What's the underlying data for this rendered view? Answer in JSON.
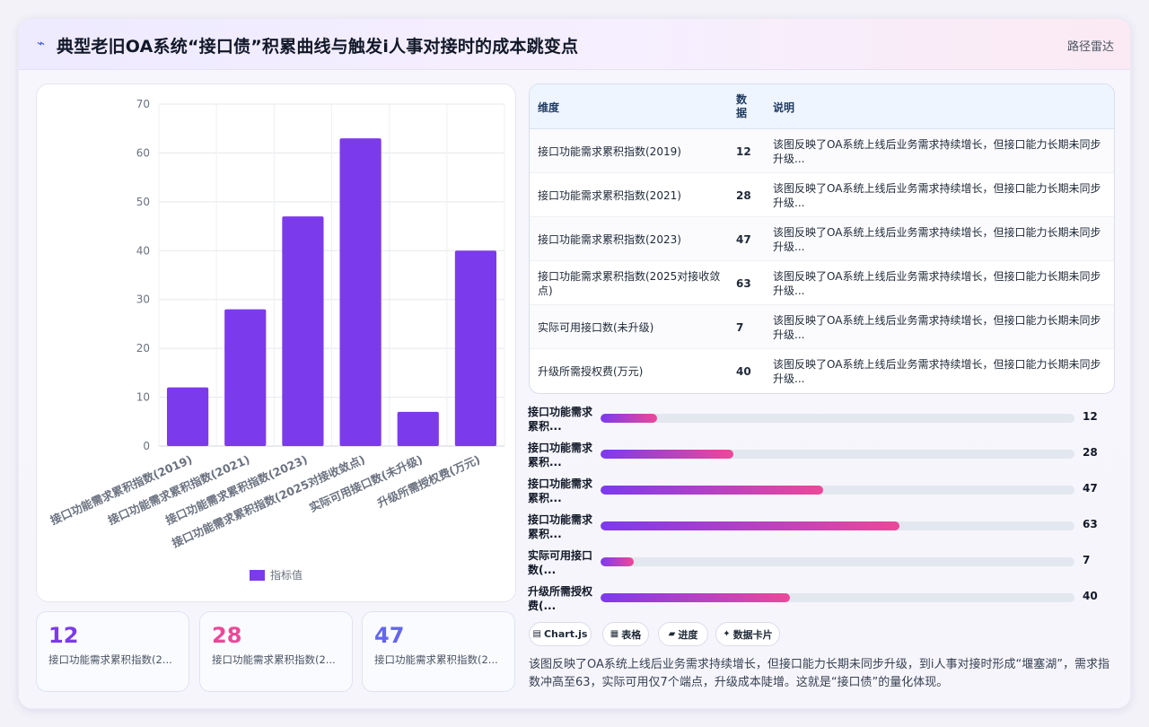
{
  "header": {
    "icon": "chart-line-icon",
    "title": "典型老旧OA系统“接口债”积累曲线与触发i人事对接时的成本跳变点",
    "right_label": "路径雷达"
  },
  "chart_data": {
    "type": "bar",
    "categories": [
      "接口功能需求累积指数(2019)",
      "接口功能需求累积指数(2021)",
      "接口功能需求累积指数(2023)",
      "接口功能需求累积指数(2025对接收敛点)",
      "实际可用接口数(未升级)",
      "升级所需授权费(万元)"
    ],
    "series": [
      {
        "name": "指标值",
        "values": [
          12,
          28,
          47,
          63,
          7,
          40
        ]
      }
    ],
    "ylim": [
      0,
      70
    ],
    "yticks": [
      0,
      10,
      20,
      30,
      40,
      50,
      60,
      70
    ],
    "grid": true,
    "legend": "bottom",
    "color": "#7c3aed"
  },
  "stats": [
    {
      "value": "12",
      "label": "接口功能需求累积指数(2...",
      "color": "#7c3aed"
    },
    {
      "value": "28",
      "label": "接口功能需求累积指数(2...",
      "color": "#ec4899"
    },
    {
      "value": "47",
      "label": "接口功能需求累积指数(2...",
      "color": "#6366f1"
    }
  ],
  "table": {
    "headers": {
      "dim": "维度",
      "num": "数据",
      "desc": "说明"
    },
    "rows": [
      {
        "dim": "接口功能需求累积指数(2019)",
        "num": "12",
        "desc": "该图反映了OA系统上线后业务需求持续增长，但接口能力长期未同步升级..."
      },
      {
        "dim": "接口功能需求累积指数(2021)",
        "num": "28",
        "desc": "该图反映了OA系统上线后业务需求持续增长，但接口能力长期未同步升级..."
      },
      {
        "dim": "接口功能需求累积指数(2023)",
        "num": "47",
        "desc": "该图反映了OA系统上线后业务需求持续增长，但接口能力长期未同步升级..."
      },
      {
        "dim": "接口功能需求累积指数(2025对接收敛点)",
        "num": "63",
        "desc": "该图反映了OA系统上线后业务需求持续增长，但接口能力长期未同步升级..."
      },
      {
        "dim": "实际可用接口数(未升级)",
        "num": "7",
        "desc": "该图反映了OA系统上线后业务需求持续增长，但接口能力长期未同步升级..."
      },
      {
        "dim": "升级所需授权费(万元)",
        "num": "40",
        "desc": "该图反映了OA系统上线后业务需求持续增长，但接口能力长期未同步升级..."
      }
    ]
  },
  "progress": {
    "max": 100,
    "items": [
      {
        "label": "接口功能需求累积...",
        "value": 12
      },
      {
        "label": "接口功能需求累积...",
        "value": 28
      },
      {
        "label": "接口功能需求累积...",
        "value": 47
      },
      {
        "label": "接口功能需求累积...",
        "value": 63
      },
      {
        "label": "实际可用接口数(...",
        "value": 7
      },
      {
        "label": "升级所需授权费(...",
        "value": 40
      }
    ]
  },
  "tags": [
    {
      "icon": "bar-chart-icon",
      "glyph": "▤",
      "label": "Chart.js"
    },
    {
      "icon": "table-icon",
      "glyph": "▦",
      "label": "表格"
    },
    {
      "icon": "progress-icon",
      "glyph": "▰",
      "label": "进度"
    },
    {
      "icon": "sparkle-icon",
      "glyph": "✦",
      "label": "数据卡片"
    }
  ],
  "note": "该图反映了OA系统上线后业务需求持续增长，但接口能力长期未同步升级，到i人事对接时形成“堰塞湖”，需求指数冲高至63，实际可用仅7个端点，升级成本陡增。这就是“接口债”的量化体现。"
}
